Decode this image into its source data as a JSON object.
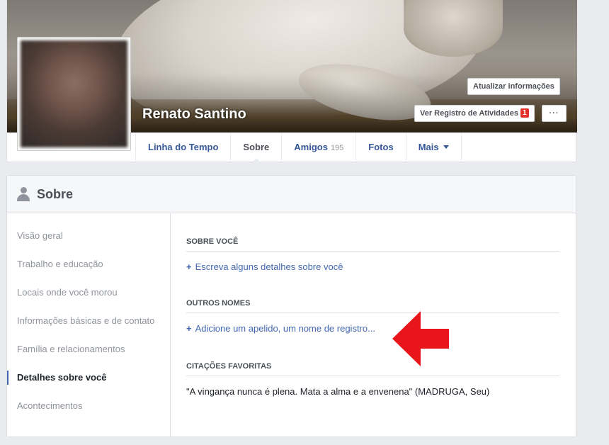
{
  "profile": {
    "name": "Renato Santino",
    "update_info_label": "Atualizar informações",
    "activity_log_label": "Ver Registro de Atividades",
    "activity_badge": "1",
    "more_label": "···"
  },
  "tabs": [
    {
      "label": "Linha do Tempo"
    },
    {
      "label": "Sobre"
    },
    {
      "label": "Amigos",
      "count": "195"
    },
    {
      "label": "Fotos"
    },
    {
      "label": "Mais"
    }
  ],
  "about": {
    "title": "Sobre",
    "nav": [
      "Visão geral",
      "Trabalho e educação",
      "Locais onde você morou",
      "Informações básicas e de contato",
      "Família e relacionamentos",
      "Detalhes sobre você",
      "Acontecimentos"
    ],
    "sections": {
      "about_you": {
        "title": "Sobre você",
        "link": "Escreva alguns detalhes sobre você"
      },
      "other_names": {
        "title": "Outros nomes",
        "link": "Adicione um apelido, um nome de registro..."
      },
      "quotes": {
        "title": "Citações favoritas",
        "text": "\"A vingança nunca é plena. Mata a alma e a envenena\" (MADRUGA, Seu)"
      }
    }
  },
  "colors": {
    "link": "#4267b2",
    "tab_text": "#365899",
    "badge": "#e4312b",
    "arrow": "#e8151b"
  }
}
